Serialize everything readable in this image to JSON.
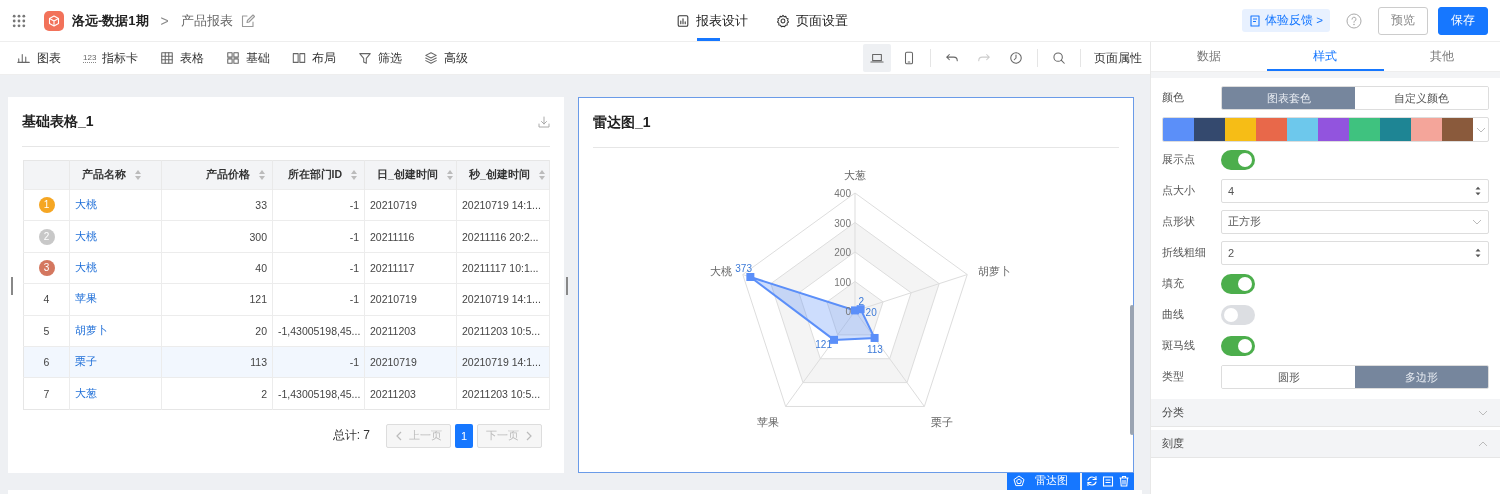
{
  "header": {
    "project": "洛远-数据1期",
    "separator": ">",
    "page": "产品报表",
    "tabs": [
      {
        "label": "报表设计",
        "selected": true
      },
      {
        "label": "页面设置",
        "selected": false
      }
    ],
    "feedback": "体验反馈 >",
    "buttons": [
      {
        "label": "预览",
        "kind": "outline"
      },
      {
        "label": "保存",
        "kind": "primary"
      }
    ]
  },
  "toolbar": {
    "items": [
      {
        "label": "图表"
      },
      {
        "label": "指标卡",
        "icon_text": "123"
      },
      {
        "label": "表格"
      },
      {
        "label": "基础"
      },
      {
        "label": "布局"
      },
      {
        "label": "筛选"
      },
      {
        "label": "高级"
      }
    ],
    "tools": [
      {
        "selected": true,
        "disabled": false
      },
      {
        "selected": false,
        "disabled": false
      },
      {
        "selected": false,
        "disabled": false
      },
      {
        "selected": false,
        "disabled": true
      },
      {
        "selected": false,
        "disabled": false
      },
      {
        "selected": false,
        "disabled": false
      }
    ],
    "page_props": "页面属性"
  },
  "table_card": {
    "title": "基础表格_1",
    "columns": [
      "产品名称",
      "产品价格",
      "所在部门ID",
      "日_创建时间",
      "秒_创建时间"
    ],
    "rows": [
      {
        "rank": "1",
        "medal": true,
        "color": "#f5a623",
        "highlighted": false,
        "cells": [
          "大桃",
          "33",
          "-1",
          "20210719",
          "20210719 14:1..."
        ]
      },
      {
        "rank": "2",
        "medal": true,
        "color": "#c8c8c8",
        "highlighted": false,
        "cells": [
          "大桃",
          "300",
          "-1",
          "20211116",
          "20211116 20:2..."
        ]
      },
      {
        "rank": "3",
        "medal": true,
        "color": "#d4775f",
        "highlighted": false,
        "cells": [
          "大桃",
          "40",
          "-1",
          "20211117",
          "20211117 10:1..."
        ]
      },
      {
        "rank": "4",
        "medal": false,
        "highlighted": false,
        "cells": [
          "苹果",
          "121",
          "-1",
          "20210719",
          "20210719 14:1..."
        ]
      },
      {
        "rank": "5",
        "medal": false,
        "highlighted": false,
        "cells": [
          "胡萝卜",
          "20",
          "-1,43005198,45...",
          "20211203",
          "20211203 10:5..."
        ]
      },
      {
        "rank": "6",
        "medal": false,
        "highlighted": true,
        "cells": [
          "栗子",
          "113",
          "-1",
          "20210719",
          "20210719 14:1..."
        ]
      },
      {
        "rank": "7",
        "medal": false,
        "highlighted": false,
        "cells": [
          "大葱",
          "2",
          "-1,43005198,45...",
          "20211203",
          "20211203 10:5..."
        ]
      }
    ],
    "total": "总计: 7",
    "pager": {
      "prev": "上一页",
      "next": "下一页",
      "pages": [
        {
          "label": "1",
          "selected": true
        }
      ]
    }
  },
  "radar_card": {
    "title": "雷达图_1",
    "selected": true,
    "tag": "雷达图",
    "chart_data": {
      "type": "radar",
      "categories": [
        "大葱",
        "胡萝卜",
        "栗子",
        "苹果",
        "大桃"
      ],
      "ylim": [
        0,
        400
      ],
      "yticks": [
        0,
        100,
        200,
        300,
        400
      ],
      "data_labels": true,
      "series": [
        {
          "color": "#5b8ff9",
          "values": [
            2,
            20,
            113,
            121,
            373
          ]
        }
      ]
    }
  },
  "panel": {
    "tabs": [
      {
        "label": "数据",
        "selected": false
      },
      {
        "label": "样式",
        "selected": true
      },
      {
        "label": "其他",
        "selected": false
      }
    ],
    "settings": [
      {
        "kind": "segmented",
        "label": "颜色",
        "options": [
          {
            "label": "图表套色",
            "selected": true
          },
          {
            "label": "自定义颜色",
            "selected": false
          }
        ]
      },
      {
        "kind": "swatches",
        "colors": [
          {
            "color": "#5b8ff9"
          },
          {
            "color": "#34496e"
          },
          {
            "color": "#f6bd16"
          },
          {
            "color": "#e8684a"
          },
          {
            "color": "#6dc8ec"
          },
          {
            "color": "#9254de"
          },
          {
            "color": "#3fc27f"
          },
          {
            "color": "#1e8594"
          },
          {
            "color": "#f4a59a"
          },
          {
            "color": "#8a5a3c"
          }
        ]
      },
      {
        "kind": "switch",
        "label": "展示点",
        "on": true
      },
      {
        "kind": "number",
        "label": "点大小",
        "value": "4"
      },
      {
        "kind": "select",
        "label": "点形状",
        "value": "正方形"
      },
      {
        "kind": "number",
        "label": "折线粗细",
        "value": "2"
      },
      {
        "kind": "switch",
        "label": "填充",
        "on": true
      },
      {
        "kind": "switch",
        "label": "曲线",
        "on": false
      },
      {
        "kind": "switch",
        "label": "斑马线",
        "on": true
      },
      {
        "kind": "segmented",
        "label": "类型",
        "options": [
          {
            "label": "圆形",
            "selected": false
          },
          {
            "label": "多边形",
            "selected": true
          }
        ]
      }
    ],
    "sections": [
      {
        "label": "分类",
        "expanded": false
      },
      {
        "label": "刻度",
        "expanded": true
      }
    ]
  }
}
